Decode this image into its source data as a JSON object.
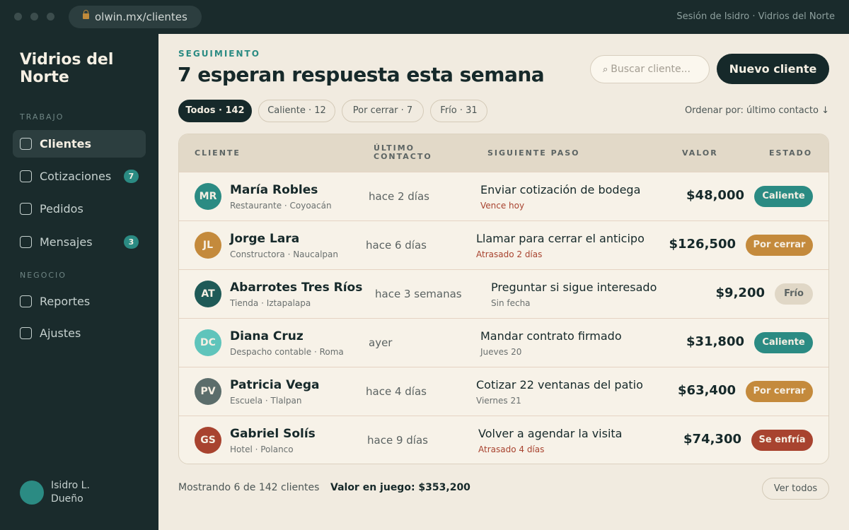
{
  "browser": {
    "url": "olwin.mx/clientes",
    "session": "Sesión de Isidro · Vidrios del Norte"
  },
  "sidebar": {
    "brand": "Vidrios del Norte",
    "section_work": "TRABAJO",
    "section_business": "NEGOCIO",
    "items": [
      {
        "label": "Clientes",
        "active": true
      },
      {
        "label": "Cotizaciones",
        "badge": "7"
      },
      {
        "label": "Pedidos"
      },
      {
        "label": "Mensajes",
        "badge": "3"
      },
      {
        "label": "Reportes"
      },
      {
        "label": "Ajustes"
      }
    ],
    "user": {
      "name": "Isidro L.",
      "role": "Dueño"
    }
  },
  "header": {
    "eyebrow": "SEGUIMIENTO",
    "title": "7 esperan respuesta esta semana",
    "search_placeholder": "Buscar cliente...",
    "new_client": "Nuevo cliente"
  },
  "filters": {
    "chips": [
      "Todos · 142",
      "Caliente · 12",
      "Por cerrar · 7",
      "Frío · 31"
    ],
    "sort": "Ordenar por: último contacto ↓"
  },
  "table": {
    "columns": [
      "CLIENTE",
      "ÚLTIMO CONTACTO",
      "SIGUIENTE PASO",
      "VALOR",
      "ESTADO"
    ],
    "rows": [
      {
        "initials": "MR",
        "name": "María Robles",
        "sub": "Restaurante · Coyoacán",
        "contact": "hace 2 días",
        "step": "Enviar cotización de bodega",
        "due": "Vence hoy",
        "value": "$48,000",
        "status": "Caliente"
      },
      {
        "initials": "JL",
        "name": "Jorge Lara",
        "sub": "Constructora · Naucalpan",
        "contact": "hace 6 días",
        "step": "Llamar para cerrar el anticipo",
        "due": "Atrasado 2 días",
        "value": "$126,500",
        "status": "Por cerrar"
      },
      {
        "initials": "AT",
        "name": "Abarrotes Tres Ríos",
        "sub": "Tienda · Iztapalapa",
        "contact": "hace 3 semanas",
        "step": "Preguntar si sigue interesado",
        "due": "Sin fecha",
        "value": "$9,200",
        "status": "Frío"
      },
      {
        "initials": "DC",
        "name": "Diana Cruz",
        "sub": "Despacho contable · Roma",
        "contact": "ayer",
        "step": "Mandar contrato firmado",
        "due": "Jueves 20",
        "value": "$31,800",
        "status": "Caliente"
      },
      {
        "initials": "PV",
        "name": "Patricia Vega",
        "sub": "Escuela · Tlalpan",
        "contact": "hace 4 días",
        "step": "Cotizar 22 ventanas del patio",
        "due": "Viernes 21",
        "value": "$63,400",
        "status": "Por cerrar"
      },
      {
        "initials": "GS",
        "name": "Gabriel Solís",
        "sub": "Hotel · Polanco",
        "contact": "hace 9 días",
        "step": "Volver a agendar la visita",
        "due": "Atrasado 4 días",
        "value": "$74,300",
        "status": "Se enfría"
      }
    ]
  },
  "footer": {
    "count": "Mostrando 6 de 142 clientes",
    "total": "Valor en juego: $353,200",
    "see_all": "Ver todos"
  },
  "colors": {
    "accent": "#2b8b83",
    "caliente": "#2b8b83",
    "por_cerrar": "#c48a3c",
    "frio": "#e0d7c6",
    "se_enfria": "#a8432f",
    "overdue": "#a8432f"
  }
}
